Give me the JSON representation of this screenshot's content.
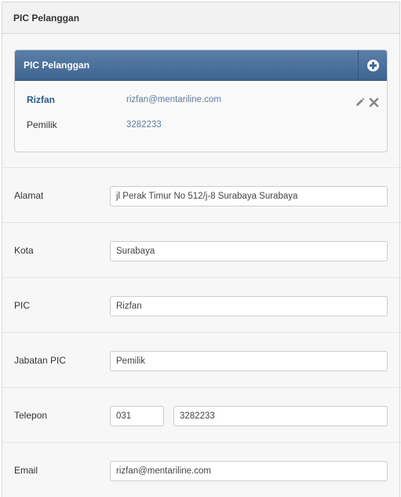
{
  "panel": {
    "title": "PIC Pelanggan"
  },
  "pic_box": {
    "title": "PIC Pelanggan",
    "add_icon": "plus-circle-icon",
    "contacts": [
      {
        "name": "Rizfan",
        "value": "rizfan@mentariline.com"
      },
      {
        "name": "Pemilik",
        "value": "3282233"
      }
    ],
    "edit_icon": "pencil-icon",
    "delete_icon": "close-icon"
  },
  "form": {
    "alamat": {
      "label": "Alamat",
      "value": "jl Perak Timur No 512/j-8 Surabaya Surabaya"
    },
    "kota": {
      "label": "Kota",
      "value": "Surabaya"
    },
    "pic": {
      "label": "PIC",
      "value": "Rizfan"
    },
    "jabatan": {
      "label": "Jabatan PIC",
      "value": "Pemilik"
    },
    "telepon": {
      "label": "Telepon",
      "area_code": "031",
      "number": "3282233"
    },
    "email": {
      "label": "Email",
      "value": "rizfan@mentariline.com"
    }
  },
  "colors": {
    "header_blue": "#3f6490",
    "link": "#2a5c8a"
  }
}
